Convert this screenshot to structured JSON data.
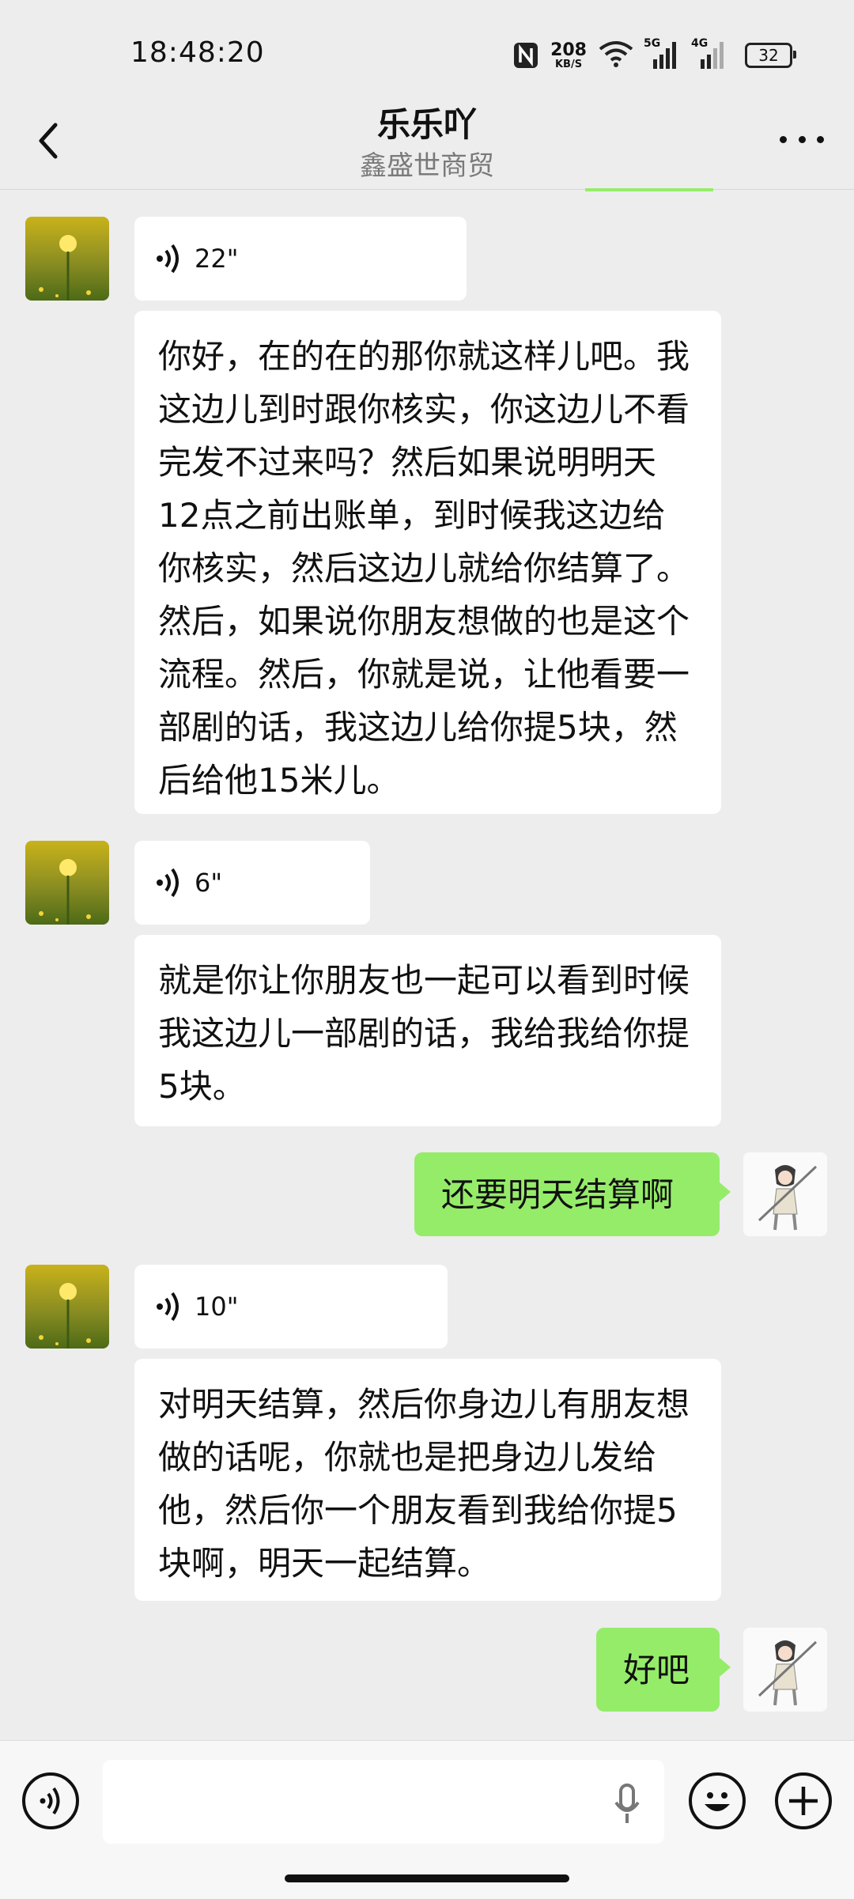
{
  "status_bar": {
    "time": "18:48:20",
    "net_speed_value": "208",
    "net_speed_unit": "KB/S",
    "sim1_label": "5G",
    "sim2_label": "4G",
    "battery": "32",
    "icons": [
      "nfc-icon",
      "wifi-icon",
      "signal-5g-icon",
      "signal-4g-icon",
      "battery-icon"
    ]
  },
  "header": {
    "title": "乐乐吖",
    "subtitle": "鑫盛世商贸",
    "back_icon": "chevron-left-icon",
    "more_icon": "more-dots-icon"
  },
  "messages": [
    {
      "sender": "other",
      "type": "voice",
      "duration": "22\""
    },
    {
      "sender": "other",
      "type": "text",
      "text": "你好，在的在的那你就这样儿吧。我这边儿到时跟你核实，你这边儿不看完发不过来吗？然后如果说明明天12点之前出账单，到时候我这边给你核实，然后这边儿就给你结算了。然后，如果说你朋友想做的也是这个流程。然后，你就是说，让他看要一部剧的话，我这边儿给你提5块，然后给他15米儿。"
    },
    {
      "sender": "other",
      "type": "voice",
      "duration": "6\""
    },
    {
      "sender": "other",
      "type": "text",
      "text": "就是你让你朋友也一起可以看到时候我这边儿一部剧的话，我给我给你提5块。"
    },
    {
      "sender": "me",
      "type": "text",
      "text": "还要明天结算啊"
    },
    {
      "sender": "other",
      "type": "voice",
      "duration": "10\""
    },
    {
      "sender": "other",
      "type": "text",
      "text": "对明天结算，然后你身边儿有朋友想做的话呢，你就也是把身边儿发给他，然后你一个朋友看到我给你提5块啊，明天一起结算。"
    },
    {
      "sender": "me",
      "type": "text",
      "text": "好吧"
    }
  ],
  "input_bar": {
    "voice_toggle_icon": "voice-input-icon",
    "mic_icon": "microphone-icon",
    "emoji_icon": "emoji-icon",
    "plus_icon": "plus-icon",
    "text_value": ""
  },
  "colors": {
    "background": "#ededed",
    "my_bubble": "#95ec69",
    "other_bubble": "#ffffff"
  }
}
